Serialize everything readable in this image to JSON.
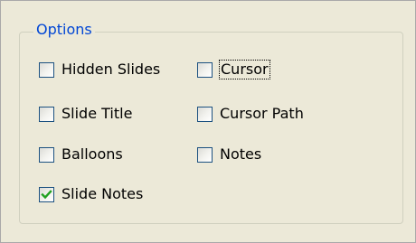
{
  "group": {
    "title": "Options"
  },
  "options": [
    {
      "label": "Hidden Slides",
      "checked": false
    },
    {
      "label": "Cursor",
      "checked": false,
      "focused": true
    },
    {
      "label": "Slide Title",
      "checked": false
    },
    {
      "label": "Cursor Path",
      "checked": false
    },
    {
      "label": "Balloons",
      "checked": false
    },
    {
      "label": "Notes",
      "checked": false
    },
    {
      "label": "Slide Notes",
      "checked": true
    }
  ],
  "colors": {
    "legend": "#0046d5",
    "checkbox_border": "#1c5180",
    "checkmark": "#21a121",
    "panel_background": "#ece9d8"
  }
}
